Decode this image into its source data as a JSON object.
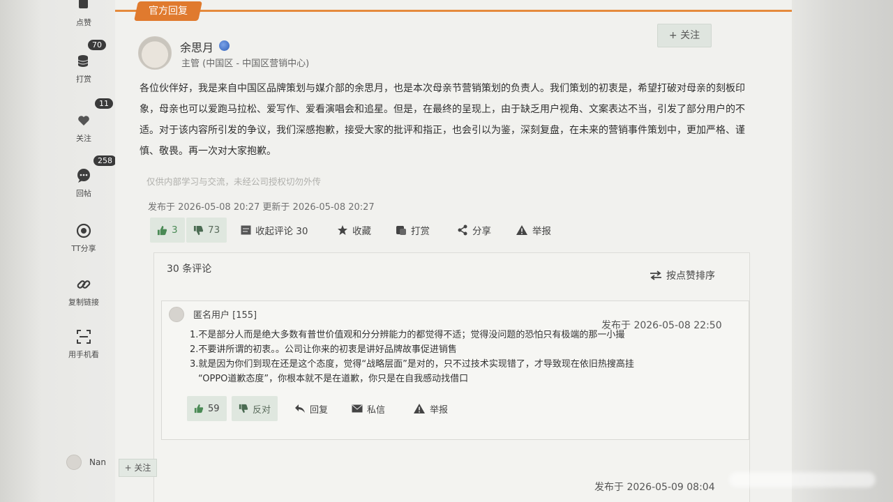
{
  "rail": {
    "items": [
      {
        "label": "点赞",
        "badge": "70",
        "icon": "thumbs-up-icon"
      },
      {
        "label": "打赏",
        "badge": "11",
        "icon": "coin-stack-icon"
      },
      {
        "label": "关注",
        "badge": "258",
        "icon": "heart-icon"
      },
      {
        "label": "回帖",
        "icon": "chat-bubble-icon"
      },
      {
        "label": "TT分享",
        "icon": "share-target-icon"
      },
      {
        "label": "复制链接",
        "icon": "link-icon"
      },
      {
        "label": "用手机看",
        "icon": "scan-icon"
      }
    ]
  },
  "post": {
    "tab_label": "官方回复",
    "follow_label": "+ 关注",
    "author_name": "余思月",
    "author_role": "主管 (中国区 - 中国区营销中心)",
    "body": "各位伙伴好，我是来自中国区品牌策划与媒介部的余思月，也是本次母亲节营销策划的负责人。我们策划的初衷是，希望打破对母亲的刻板印象，母亲也可以爱跑马拉松、爱写作、爱看演唱会和追星。但是，在最终的呈现上，由于缺乏用户视角、文案表达不当，引发了部分用户的不适。对于该内容所引发的争议，我们深感抱歉，接受大家的批评和指正，也会引以为鉴，深刻复盘，在未来的营销事件策划中，更加严格、谨慎、敬畏。再一次对大家抱歉。",
    "disclaimer": "仅供内部学习与交流，未经公司授权切勿外传",
    "publish_info": "发布于 2026-05-08 20:27 更新于 2026-05-08 20:27",
    "actions": {
      "up_count": "3",
      "down_count": "73",
      "collapse_label": "收起评论 30",
      "favorite_label": "收藏",
      "reward_label": "打赏",
      "share_label": "分享",
      "report_label": "举报"
    }
  },
  "comments": {
    "count_label": "30 条评论",
    "sort_label": "按点赞排序",
    "items": [
      {
        "user": "匿名用户 [155]",
        "time": "发布于 2026-05-08 22:50",
        "lines": [
          "1.不是部分人而是绝大多数有普世价值观和分分辨能力的都觉得不适；觉得没问题的恐怕只有极端的那一小撮",
          "2.不要讲所谓的初衷。。公司让你来的初衷是讲好品牌故事促进销售",
          "3.就是因为你们到现在还是这个态度，觉得“战略层面”是对的，只不过技术实现错了，才导致现在依旧热搜高挂",
          "“OPPO道歉态度”，你根本就不是在道歉，你只是在自我感动找借口"
        ],
        "up_count": "59",
        "down_label": "反对",
        "reply_label": "回复",
        "message_label": "私信",
        "report_label": "举报"
      },
      {
        "user": "Nan",
        "follow_label": "+ 关注",
        "time": "发布于 2026-05-09 08:04"
      }
    ]
  }
}
